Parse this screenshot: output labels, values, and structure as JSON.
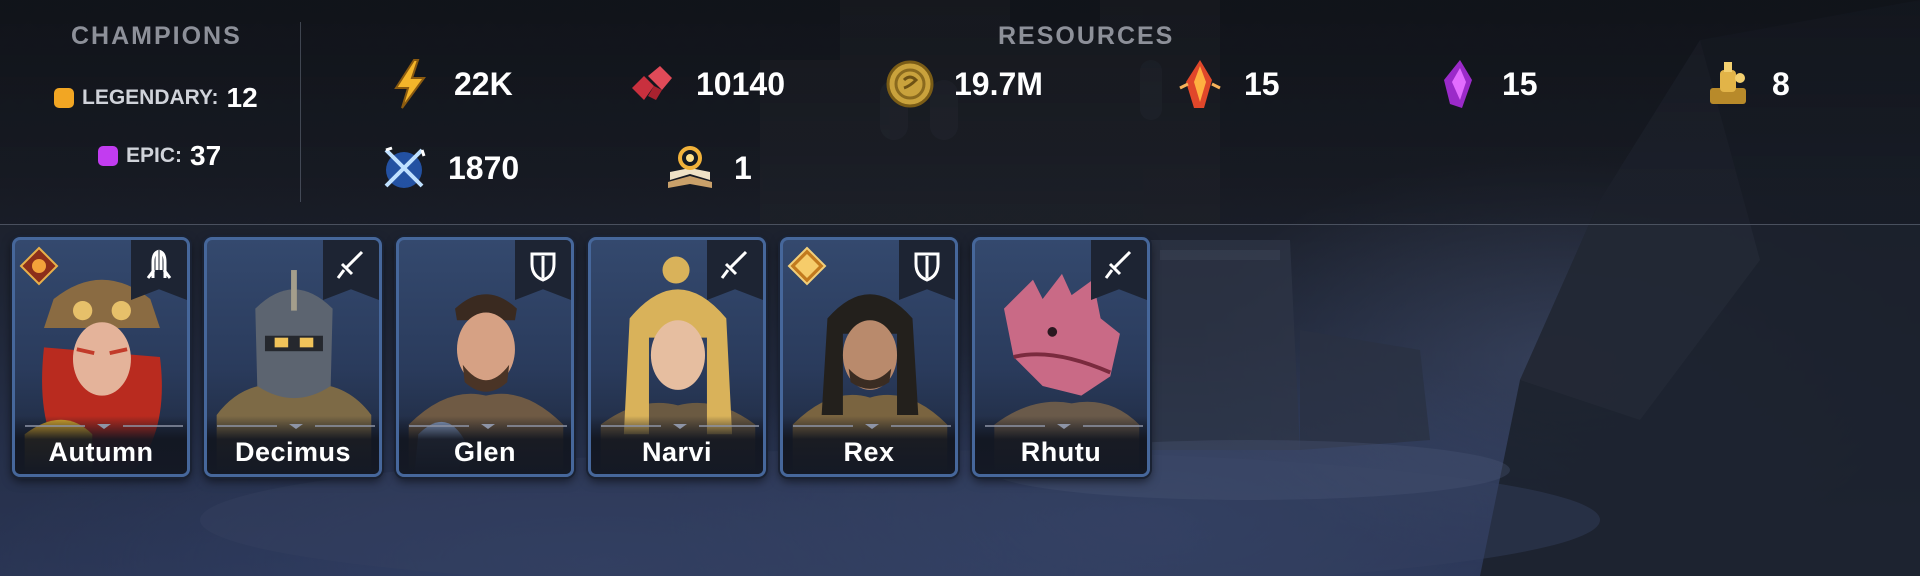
{
  "champions": {
    "title": "CHAMPIONS",
    "counts": [
      {
        "label": "LEGENDARY:",
        "value": "12",
        "color": "#f2a623"
      },
      {
        "label": "EPIC:",
        "value": "37",
        "color": "#c23cf0"
      }
    ]
  },
  "resources": {
    "title": "RESOURCES",
    "items": [
      {
        "icon": "energy-icon",
        "value": "22K"
      },
      {
        "icon": "rubies-icon",
        "value": "10140"
      },
      {
        "icon": "silver-coin-icon",
        "value": "19.7M"
      },
      {
        "icon": "sacred-shard-icon",
        "value": "15"
      },
      {
        "icon": "void-shard-icon",
        "value": "15"
      },
      {
        "icon": "gold-potion-icon",
        "value": "8"
      },
      {
        "icon": "arena-tokens-icon",
        "value": "1870"
      },
      {
        "icon": "book-icon",
        "value": "1"
      }
    ]
  },
  "cards": [
    {
      "name": "Autumn",
      "role": "support-icon",
      "affinity": "force",
      "portrait": "owl"
    },
    {
      "name": "Decimus",
      "role": "attack-icon",
      "affinity": null,
      "portrait": "helm"
    },
    {
      "name": "Glen",
      "role": "defense-icon",
      "affinity": null,
      "portrait": "man"
    },
    {
      "name": "Narvi",
      "role": "attack-icon",
      "affinity": null,
      "portrait": "woman"
    },
    {
      "name": "Rex",
      "role": "defense-icon",
      "affinity": "spirit",
      "portrait": "rogue"
    },
    {
      "name": "Rhutu",
      "role": "attack-icon",
      "affinity": null,
      "portrait": "lizard"
    }
  ]
}
